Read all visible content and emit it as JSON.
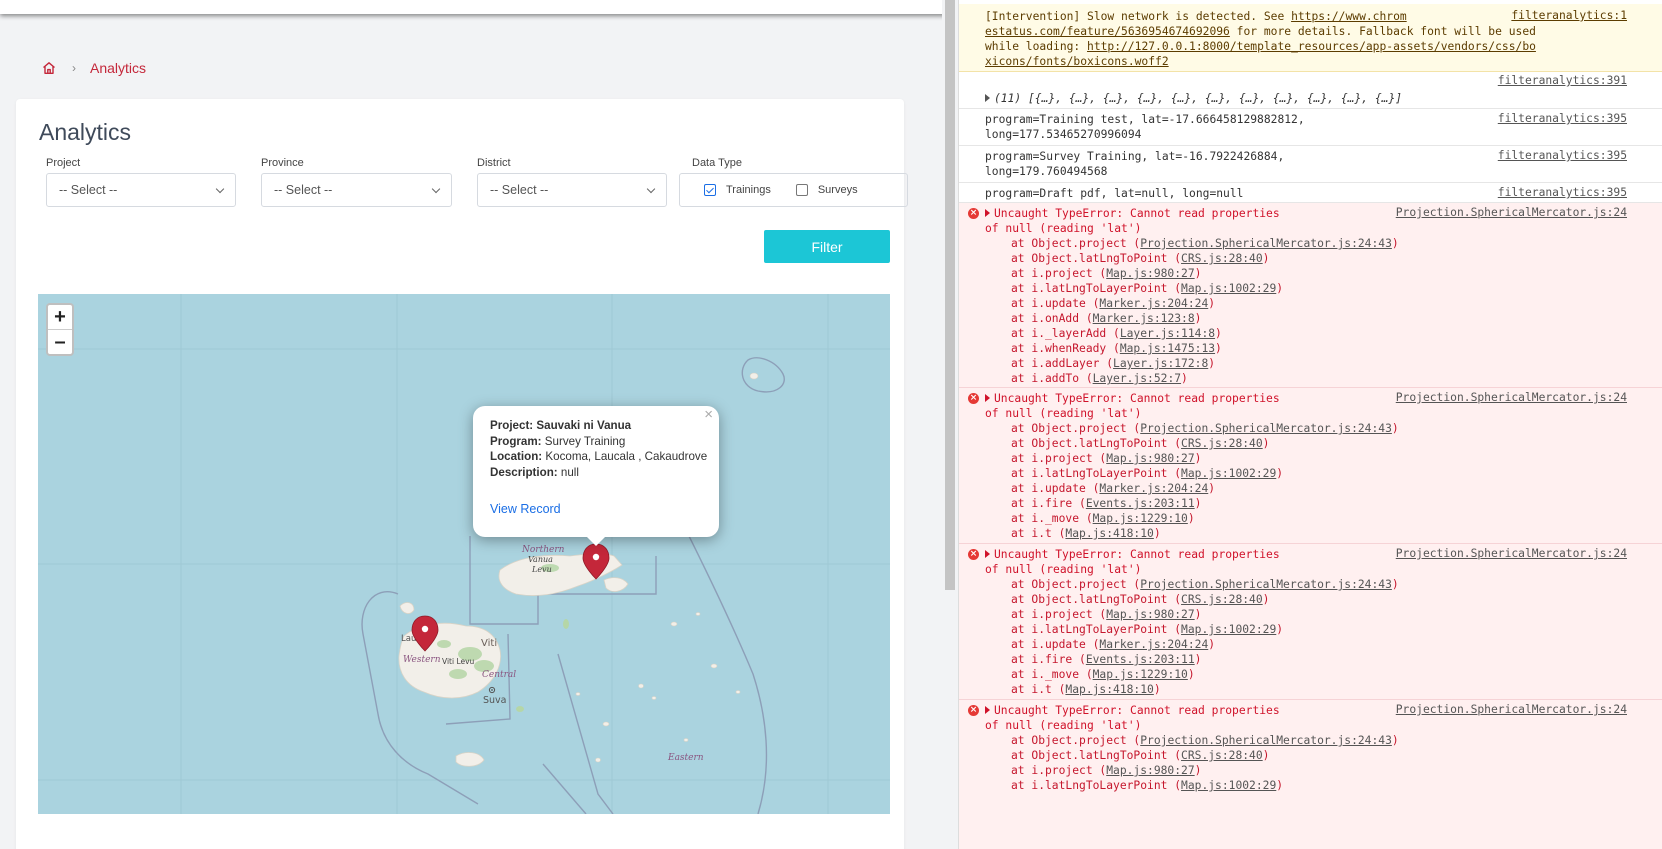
{
  "breadcrumb": {
    "current": "Analytics"
  },
  "page": {
    "title": "Analytics"
  },
  "filters": {
    "project": {
      "label": "Project",
      "value": "-- Select --"
    },
    "province": {
      "label": "Province",
      "value": "-- Select --"
    },
    "district": {
      "label": "District",
      "value": "-- Select --"
    },
    "data_type": {
      "label": "Data Type",
      "trainings_label": "Trainings",
      "trainings_checked": true,
      "surveys_label": "Surveys",
      "surveys_checked": false
    },
    "filter_button": "Filter"
  },
  "map": {
    "zoom_in": "+",
    "zoom_out": "–",
    "place_labels": {
      "lautoka": "Lautoka",
      "western": "Western",
      "viti_levu": "Viti Levu",
      "viti": "Viti",
      "central": "Central",
      "suva": "Suva",
      "northern": "Northern",
      "vanua": "Vanua",
      "levu": "Levu",
      "eastern": "Eastern"
    },
    "popup": {
      "project_key": "Project:",
      "project_val": "Sauvaki ni Vanua",
      "program_key": "Program:",
      "program_val": "Survey Training",
      "location_key": "Location:",
      "location_val": "Kocoma, Laucala , Cakaudrove",
      "description_key": "Description:",
      "description_val": "null",
      "link": "View Record",
      "close": "×"
    },
    "colors": {
      "sea": "#aad3df",
      "land": "#f2efe9",
      "marker": "#c4273a"
    }
  },
  "console": {
    "warning": {
      "lines": [
        "[Intervention] Slow network is detected. See ",
        "https://www.chrom",
        "estatus.com/feature/5636954674692096",
        " for more details. Fallback font will be used",
        "while loading: ",
        "http://127.0.0.1:8000/template_resources/app-assets/vendors/css/bo",
        "xicons/fonts/boxicons.woff2"
      ],
      "source": "filteranalytics:1"
    },
    "logs": [
      {
        "text": "(11) [{…}, {…}, {…}, {…}, {…}, {…}, {…}, {…}, {…}, {…}, {…}]",
        "source": "filteranalytics:391"
      },
      {
        "text": "program=Training test, lat=-17.666458129882812,",
        "text2": "long=177.53465270996094",
        "source": "filteranalytics:395"
      },
      {
        "text": "program=Survey Training, lat=-16.7922426884,",
        "text2": "long=179.760494568",
        "source": "filteranalytics:395"
      },
      {
        "text": "program=Draft pdf, lat=null, long=null",
        "source": "filteranalytics:395"
      }
    ],
    "error_head1": "Uncaught TypeError: Cannot read properties",
    "error_head2": "of null (reading 'lat')",
    "error_source": "Projection.SphericalMercator.js:24",
    "error1_frames": [
      [
        "at Object.project (",
        "Projection.SphericalMercator.js:24:43",
        ")"
      ],
      [
        "at Object.latLngToPoint (",
        "CRS.js:28:40",
        ")"
      ],
      [
        "at i.project (",
        "Map.js:980:27",
        ")"
      ],
      [
        "at i.latLngToLayerPoint (",
        "Map.js:1002:29",
        ")"
      ],
      [
        "at i.update (",
        "Marker.js:204:24",
        ")"
      ],
      [
        "at i.onAdd (",
        "Marker.js:123:8",
        ")"
      ],
      [
        "at i._layerAdd (",
        "Layer.js:114:8",
        ")"
      ],
      [
        "at i.whenReady (",
        "Map.js:1475:13",
        ")"
      ],
      [
        "at i.addLayer (",
        "Layer.js:172:8",
        ")"
      ],
      [
        "at i.addTo (",
        "Layer.js:52:7",
        ")"
      ]
    ],
    "error2_frames": [
      [
        "at Object.project (",
        "Projection.SphericalMercator.js:24:43",
        ")"
      ],
      [
        "at Object.latLngToPoint (",
        "CRS.js:28:40",
        ")"
      ],
      [
        "at i.project (",
        "Map.js:980:27",
        ")"
      ],
      [
        "at i.latLngToLayerPoint (",
        "Map.js:1002:29",
        ")"
      ],
      [
        "at i.update (",
        "Marker.js:204:24",
        ")"
      ],
      [
        "at i.fire (",
        "Events.js:203:11",
        ")"
      ],
      [
        "at i._move (",
        "Map.js:1229:10",
        ")"
      ],
      [
        "at i.t (",
        "Map.js:418:10",
        ")"
      ]
    ],
    "error3_frames": [
      [
        "at Object.project (",
        "Projection.SphericalMercator.js:24:43",
        ")"
      ],
      [
        "at Object.latLngToPoint (",
        "CRS.js:28:40",
        ")"
      ],
      [
        "at i.project (",
        "Map.js:980:27",
        ")"
      ],
      [
        "at i.latLngToLayerPoint (",
        "Map.js:1002:29",
        ")"
      ],
      [
        "at i.update (",
        "Marker.js:204:24",
        ")"
      ],
      [
        "at i.fire (",
        "Events.js:203:11",
        ")"
      ],
      [
        "at i._move (",
        "Map.js:1229:10",
        ")"
      ],
      [
        "at i.t (",
        "Map.js:418:10",
        ")"
      ]
    ],
    "error4_frames": [
      [
        "at Object.project (",
        "Projection.SphericalMercator.js:24:43",
        ")"
      ],
      [
        "at Object.latLngToPoint (",
        "CRS.js:28:40",
        ")"
      ],
      [
        "at i.project (",
        "Map.js:980:27",
        ")"
      ],
      [
        "at i.latLngToLayerPoint (",
        "Map.js:1002:29",
        ")"
      ]
    ]
  }
}
